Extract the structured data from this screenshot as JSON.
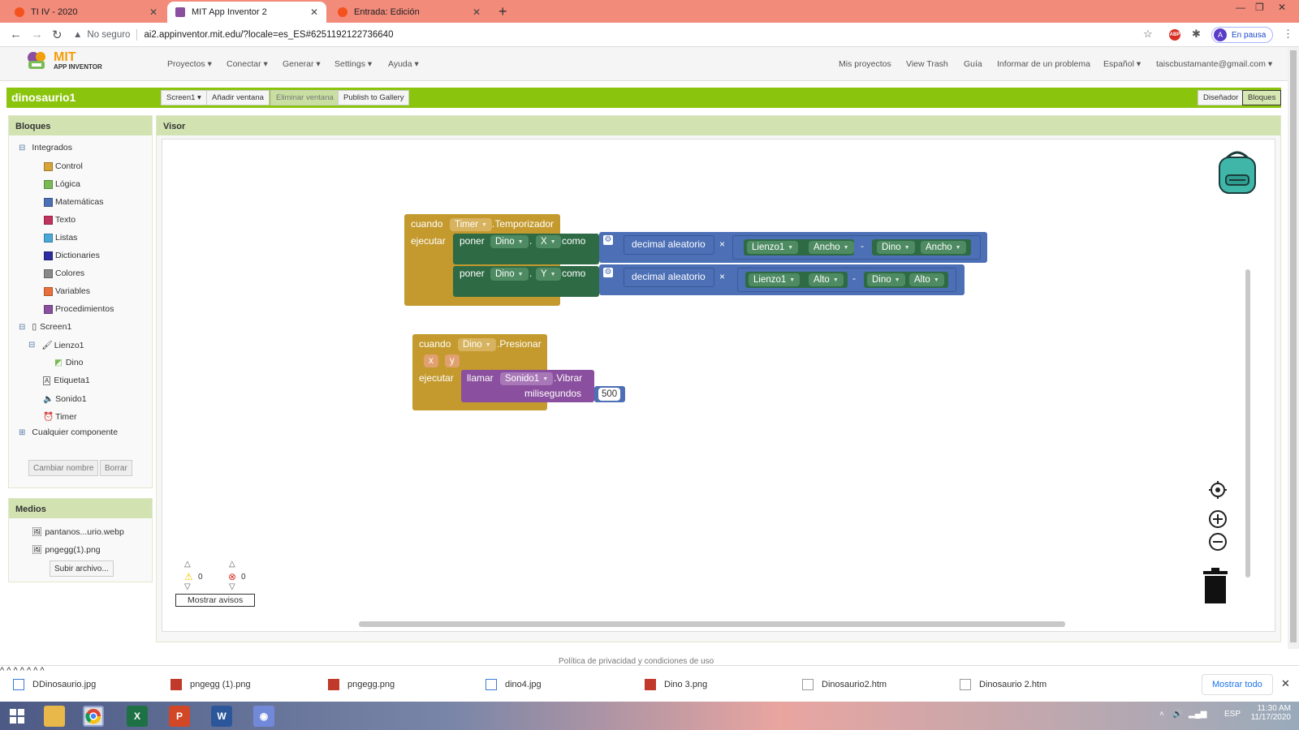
{
  "browser": {
    "tabs": [
      {
        "title": "TI IV - 2020",
        "active": false
      },
      {
        "title": "MIT App Inventor 2",
        "active": true
      },
      {
        "title": "Entrada: Edición",
        "active": false
      }
    ],
    "security_label": "No seguro",
    "url": "ai2.appinventor.mit.edu/?locale=es_ES#6251192122736640",
    "profile_initial": "A",
    "profile_status": "En pausa",
    "abp_label": "ABP"
  },
  "app_header": {
    "logo_top": "MIT",
    "logo_bottom": "APP INVENTOR",
    "left_menu": [
      "Proyectos ▾",
      "Conectar ▾",
      "Generar ▾",
      "Settings ▾",
      "Ayuda ▾"
    ],
    "right_menu": [
      "Mis proyectos",
      "View Trash",
      "Guía",
      "Informar de un problema",
      "Español ▾",
      "taiscbustamante@gmail.com ▾"
    ]
  },
  "project_bar": {
    "name": "dinosaurio1",
    "screen_btn": "Screen1 ▾",
    "add_screen": "Añadir ventana",
    "remove_screen": "Eliminar ventana",
    "publish": "Publish to Gallery",
    "designer": "Diseñador",
    "blocks": "Bloques"
  },
  "blocks_panel": {
    "title": "Bloques",
    "builtin_label": "Integrados",
    "builtin": [
      {
        "label": "Control",
        "color": "#d6a43a"
      },
      {
        "label": "Lógica",
        "color": "#7aba55"
      },
      {
        "label": "Matemáticas",
        "color": "#4c6fb5"
      },
      {
        "label": "Texto",
        "color": "#c2325f"
      },
      {
        "label": "Listas",
        "color": "#4aa8d6"
      },
      {
        "label": "Dictionaries",
        "color": "#2d2d9e"
      },
      {
        "label": "Colores",
        "color": "#888888"
      },
      {
        "label": "Variables",
        "color": "#e8703a"
      },
      {
        "label": "Procedimientos",
        "color": "#8a4f9e"
      }
    ],
    "screen": "Screen1",
    "components": {
      "canvas": "Lienzo1",
      "sprite": "Dino",
      "label": "Etiqueta1",
      "sound": "Sonido1",
      "timer": "Timer"
    },
    "any_component": "Cualquier componente",
    "rename_btn": "Cambiar nombre",
    "delete_btn": "Borrar"
  },
  "media_panel": {
    "title": "Medios",
    "files": [
      "pantanos...urio.webp",
      "pngegg(1).png"
    ],
    "upload_btn": "Subir archivo..."
  },
  "viewer": {
    "title": "Visor",
    "warnings": "0",
    "errors": "0",
    "show_warnings": "Mostrar avisos",
    "footer_text": "Política de privacidad y condiciones de uso"
  },
  "blocks": {
    "timer_event": {
      "when": "cuando",
      "component": "Timer",
      "event": ".Temporizador",
      "do": "ejecutar",
      "set1": {
        "verb": "poner",
        "component": "Dino",
        "prop": "X",
        "as": "como",
        "op": "decimal aleatorio",
        "times": "×",
        "minus": "-",
        "a": "Lienzo1",
        "ap": "Ancho",
        "b": "Dino",
        "bp": "Ancho"
      },
      "set2": {
        "verb": "poner",
        "component": "Dino",
        "prop": "Y",
        "as": "como",
        "op": "decimal aleatorio",
        "times": "×",
        "minus": "-",
        "a": "Lienzo1",
        "ap": "Alto",
        "b": "Dino",
        "bp": "Alto"
      }
    },
    "touch_event": {
      "when": "cuando",
      "component": "Dino",
      "event": ".Presionar",
      "param_x": "x",
      "param_y": "y",
      "do": "ejecutar",
      "call": "llamar",
      "call_component": "Sonido1",
      "method": ".Vibrar",
      "arg": "milisegundos",
      "value": "500"
    }
  },
  "downloads": {
    "files": [
      "DDinosaurio.jpg",
      "pngegg (1).png",
      "pngegg.png",
      "dino4.jpg",
      "Dino 3.png",
      "Dinosaurio2.htm",
      "Dinosaurio 2.htm"
    ],
    "show_all": "Mostrar todo"
  },
  "taskbar": {
    "lang": "ESP",
    "time": "11:30 AM",
    "date": "11/17/2020"
  }
}
